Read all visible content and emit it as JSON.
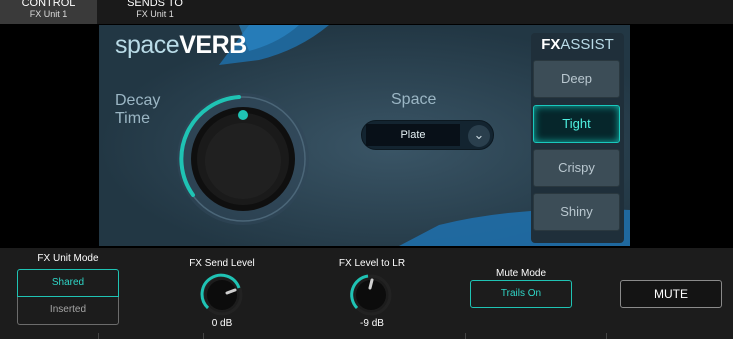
{
  "tabs": [
    {
      "title": "CONTROL",
      "subtitle": "FX Unit 1",
      "active": true
    },
    {
      "title": "SENDS TO",
      "subtitle": "FX Unit 1",
      "active": false
    }
  ],
  "plugin": {
    "logo_light": "space",
    "logo_bold": "VERB",
    "decay_label": "Decay Time",
    "space_label": "Space",
    "space_value": "Plate",
    "space_chevron_icon": "chevron-down-icon"
  },
  "fx_assist": {
    "title_bold": "FX",
    "title_light": "ASSIST",
    "buttons": [
      "Deep",
      "Tight",
      "Crispy",
      "Shiny"
    ],
    "active": "Tight"
  },
  "bottom": {
    "fx_unit_mode_label": "FX Unit Mode",
    "fx_unit_mode_options": [
      "Shared",
      "Inserted"
    ],
    "fx_unit_mode_selected": "Shared",
    "fx_send_level_label": "FX Send Level",
    "fx_send_level_value": "0 dB",
    "fx_level_lr_label": "FX Level to LR",
    "fx_level_lr_value": "-9 dB",
    "mute_mode_label": "Mute Mode",
    "mute_mode_value": "Trails On",
    "mute_label": "MUTE"
  },
  "colors": {
    "accent": "#1fc3b4",
    "panel": "#2b4150",
    "brand_blue": "#1f6ea8"
  }
}
